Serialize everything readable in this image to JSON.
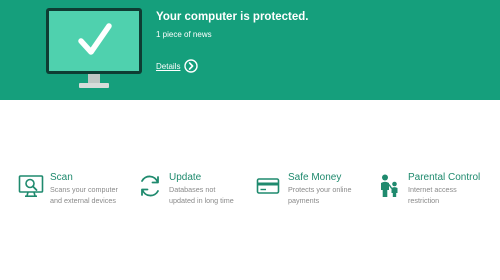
{
  "colors": {
    "hero_background": "#159f7c",
    "hero_text": "#ffffff",
    "screen_fill": "#4fd1ae",
    "accent": "#1f8a6e",
    "description_text": "#8a8a8a"
  },
  "status": {
    "icon": "monitor-checkmark-icon",
    "title": "Your computer is protected.",
    "news": "1 piece of news",
    "details_label": "Details",
    "details_icon": "chevron-right-circle-icon"
  },
  "tiles": [
    {
      "icon": "scan-monitor-icon",
      "title": "Scan",
      "description_line1": "Scans your computer",
      "description_line2": "and external devices"
    },
    {
      "icon": "refresh-arrows-icon",
      "title": "Update",
      "description_line1": "Databases not",
      "description_line2": "updated in long time"
    },
    {
      "icon": "credit-card-icon",
      "title": "Safe Money",
      "description_line1": "Protects your online",
      "description_line2": "payments"
    },
    {
      "icon": "parent-child-icon",
      "title": "Parental Control",
      "description_line1": "Internet access",
      "description_line2": "restriction"
    }
  ]
}
